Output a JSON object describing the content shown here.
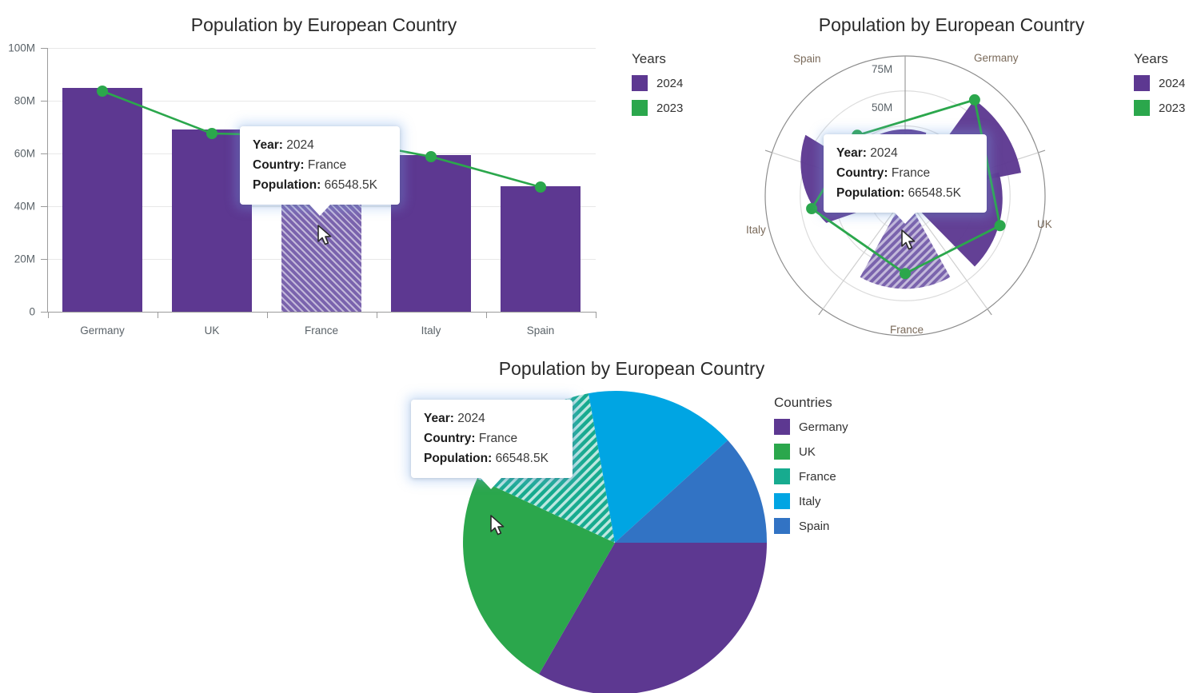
{
  "charts": [
    {
      "id": "bar-chart",
      "title": "Population by European Country",
      "legend_title": "Years",
      "legend": [
        {
          "label": "2024",
          "color": "#5d3891"
        },
        {
          "label": "2023",
          "color": "#2ba74c"
        }
      ]
    },
    {
      "id": "polar-chart",
      "title": "Population by European Country",
      "legend_title": "Years",
      "legend": [
        {
          "label": "2024",
          "color": "#5d3891"
        },
        {
          "label": "2023",
          "color": "#2ba74c"
        }
      ]
    },
    {
      "id": "pie-chart",
      "title": "Population by European Country",
      "legend_title": "Countries",
      "legend": [
        {
          "label": "Germany",
          "color": "#5d3891"
        },
        {
          "label": "UK",
          "color": "#2ba74c"
        },
        {
          "label": "France",
          "color": "#17ab8f"
        },
        {
          "label": "Italy",
          "color": "#00a5e3"
        },
        {
          "label": "Spain",
          "color": "#3273c4"
        }
      ]
    }
  ],
  "tooltip": {
    "year_key": "Year:",
    "year_value": "2024",
    "country_key": "Country:",
    "country_value": "France",
    "population_key": "Population:",
    "population_value": "66548.5K"
  },
  "chart_data": [
    {
      "type": "bar",
      "title": "Population by European Country",
      "xlabel": "",
      "ylabel": "",
      "categories": [
        "Germany",
        "UK",
        "France",
        "Italy",
        "Spain"
      ],
      "ytick_labels": [
        "0",
        "20M",
        "40M",
        "60M",
        "80M",
        "100M"
      ],
      "ytick_values": [
        0,
        20000000,
        40000000,
        60000000,
        80000000,
        100000000
      ],
      "ylim": [
        0,
        100000000
      ],
      "grid": true,
      "legend_position": "right",
      "legend_title": "Years",
      "series": [
        {
          "name": "2024",
          "chart_type": "column",
          "color": "#5d3891",
          "values": [
            84670000,
            69000000,
            66548500,
            59500000,
            47700000
          ],
          "highlighted_index": 2
        },
        {
          "name": "2023",
          "chart_type": "line",
          "color": "#2ba74c",
          "values": [
            83500000,
            67400000,
            66548500,
            58800000,
            47400000
          ]
        }
      ]
    },
    {
      "type": "polar",
      "title": "Population by European Country",
      "categories": [
        "Germany",
        "UK",
        "France",
        "Italy",
        "Spain"
      ],
      "rtick_labels": [
        "50M",
        "75M"
      ],
      "rtick_values": [
        50000000,
        75000000
      ],
      "rlim": [
        0,
        100000000
      ],
      "grid": true,
      "legend_position": "right",
      "legend_title": "Years",
      "series": [
        {
          "name": "2024",
          "chart_type": "polar-column",
          "color": "#5d3891",
          "values": [
            84670000,
            69000000,
            66548500,
            59500000,
            47700000
          ],
          "highlighted_index": 2
        },
        {
          "name": "2023",
          "chart_type": "polar-line",
          "color": "#2ba74c",
          "values": [
            83500000,
            67400000,
            66548500,
            58800000,
            47400000
          ]
        }
      ]
    },
    {
      "type": "pie",
      "title": "Population by European Country",
      "legend_position": "right",
      "legend_title": "Countries",
      "categories": [
        "Germany",
        "UK",
        "France",
        "Italy",
        "Spain"
      ],
      "values": [
        84670000,
        59500000,
        66548500,
        47700000,
        69000000
      ],
      "slice_degrees": [
        120,
        85,
        55,
        58,
        42
      ],
      "colors": [
        "#5d3891",
        "#2ba74c",
        "#17ab8f",
        "#00a5e3",
        "#3273c4"
      ],
      "highlighted_category": "France"
    }
  ],
  "cursor": {
    "icon": "mouse-pointer"
  }
}
